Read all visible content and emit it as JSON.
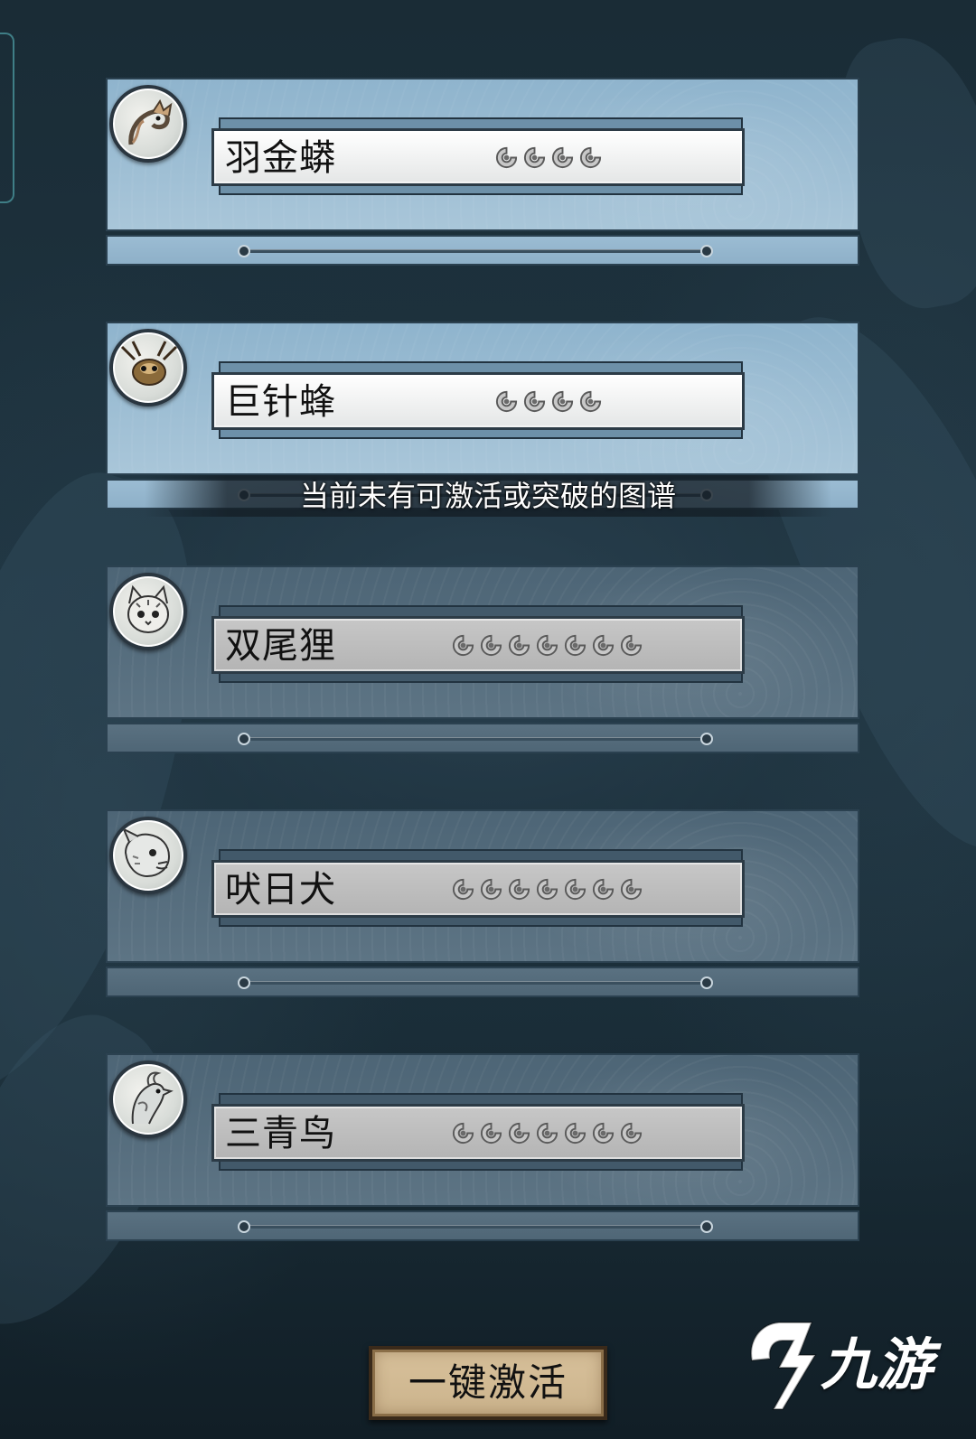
{
  "cards": [
    {
      "name": "羽金蟒",
      "stars": 4,
      "state": "lit",
      "avatar_icon": "serpent-icon"
    },
    {
      "name": "巨针蜂",
      "stars": 4,
      "state": "lit",
      "avatar_icon": "wasp-icon"
    },
    {
      "name": "双尾狸",
      "stars": 7,
      "state": "dim",
      "avatar_icon": "cat-icon"
    },
    {
      "name": "吠日犬",
      "stars": 7,
      "state": "dim",
      "avatar_icon": "dog-icon"
    },
    {
      "name": "三青鸟",
      "stars": 7,
      "state": "dim",
      "avatar_icon": "bird-icon"
    }
  ],
  "toast": "当前未有可激活或突破的图谱",
  "activate_button": "一键激活",
  "watermark": {
    "text": "九游",
    "icon": "jiuyou-logo-icon"
  },
  "colors": {
    "lit_panel": "#a9c6d9",
    "dim_panel": "#5d7484",
    "button_fill": "#d8c19b"
  }
}
